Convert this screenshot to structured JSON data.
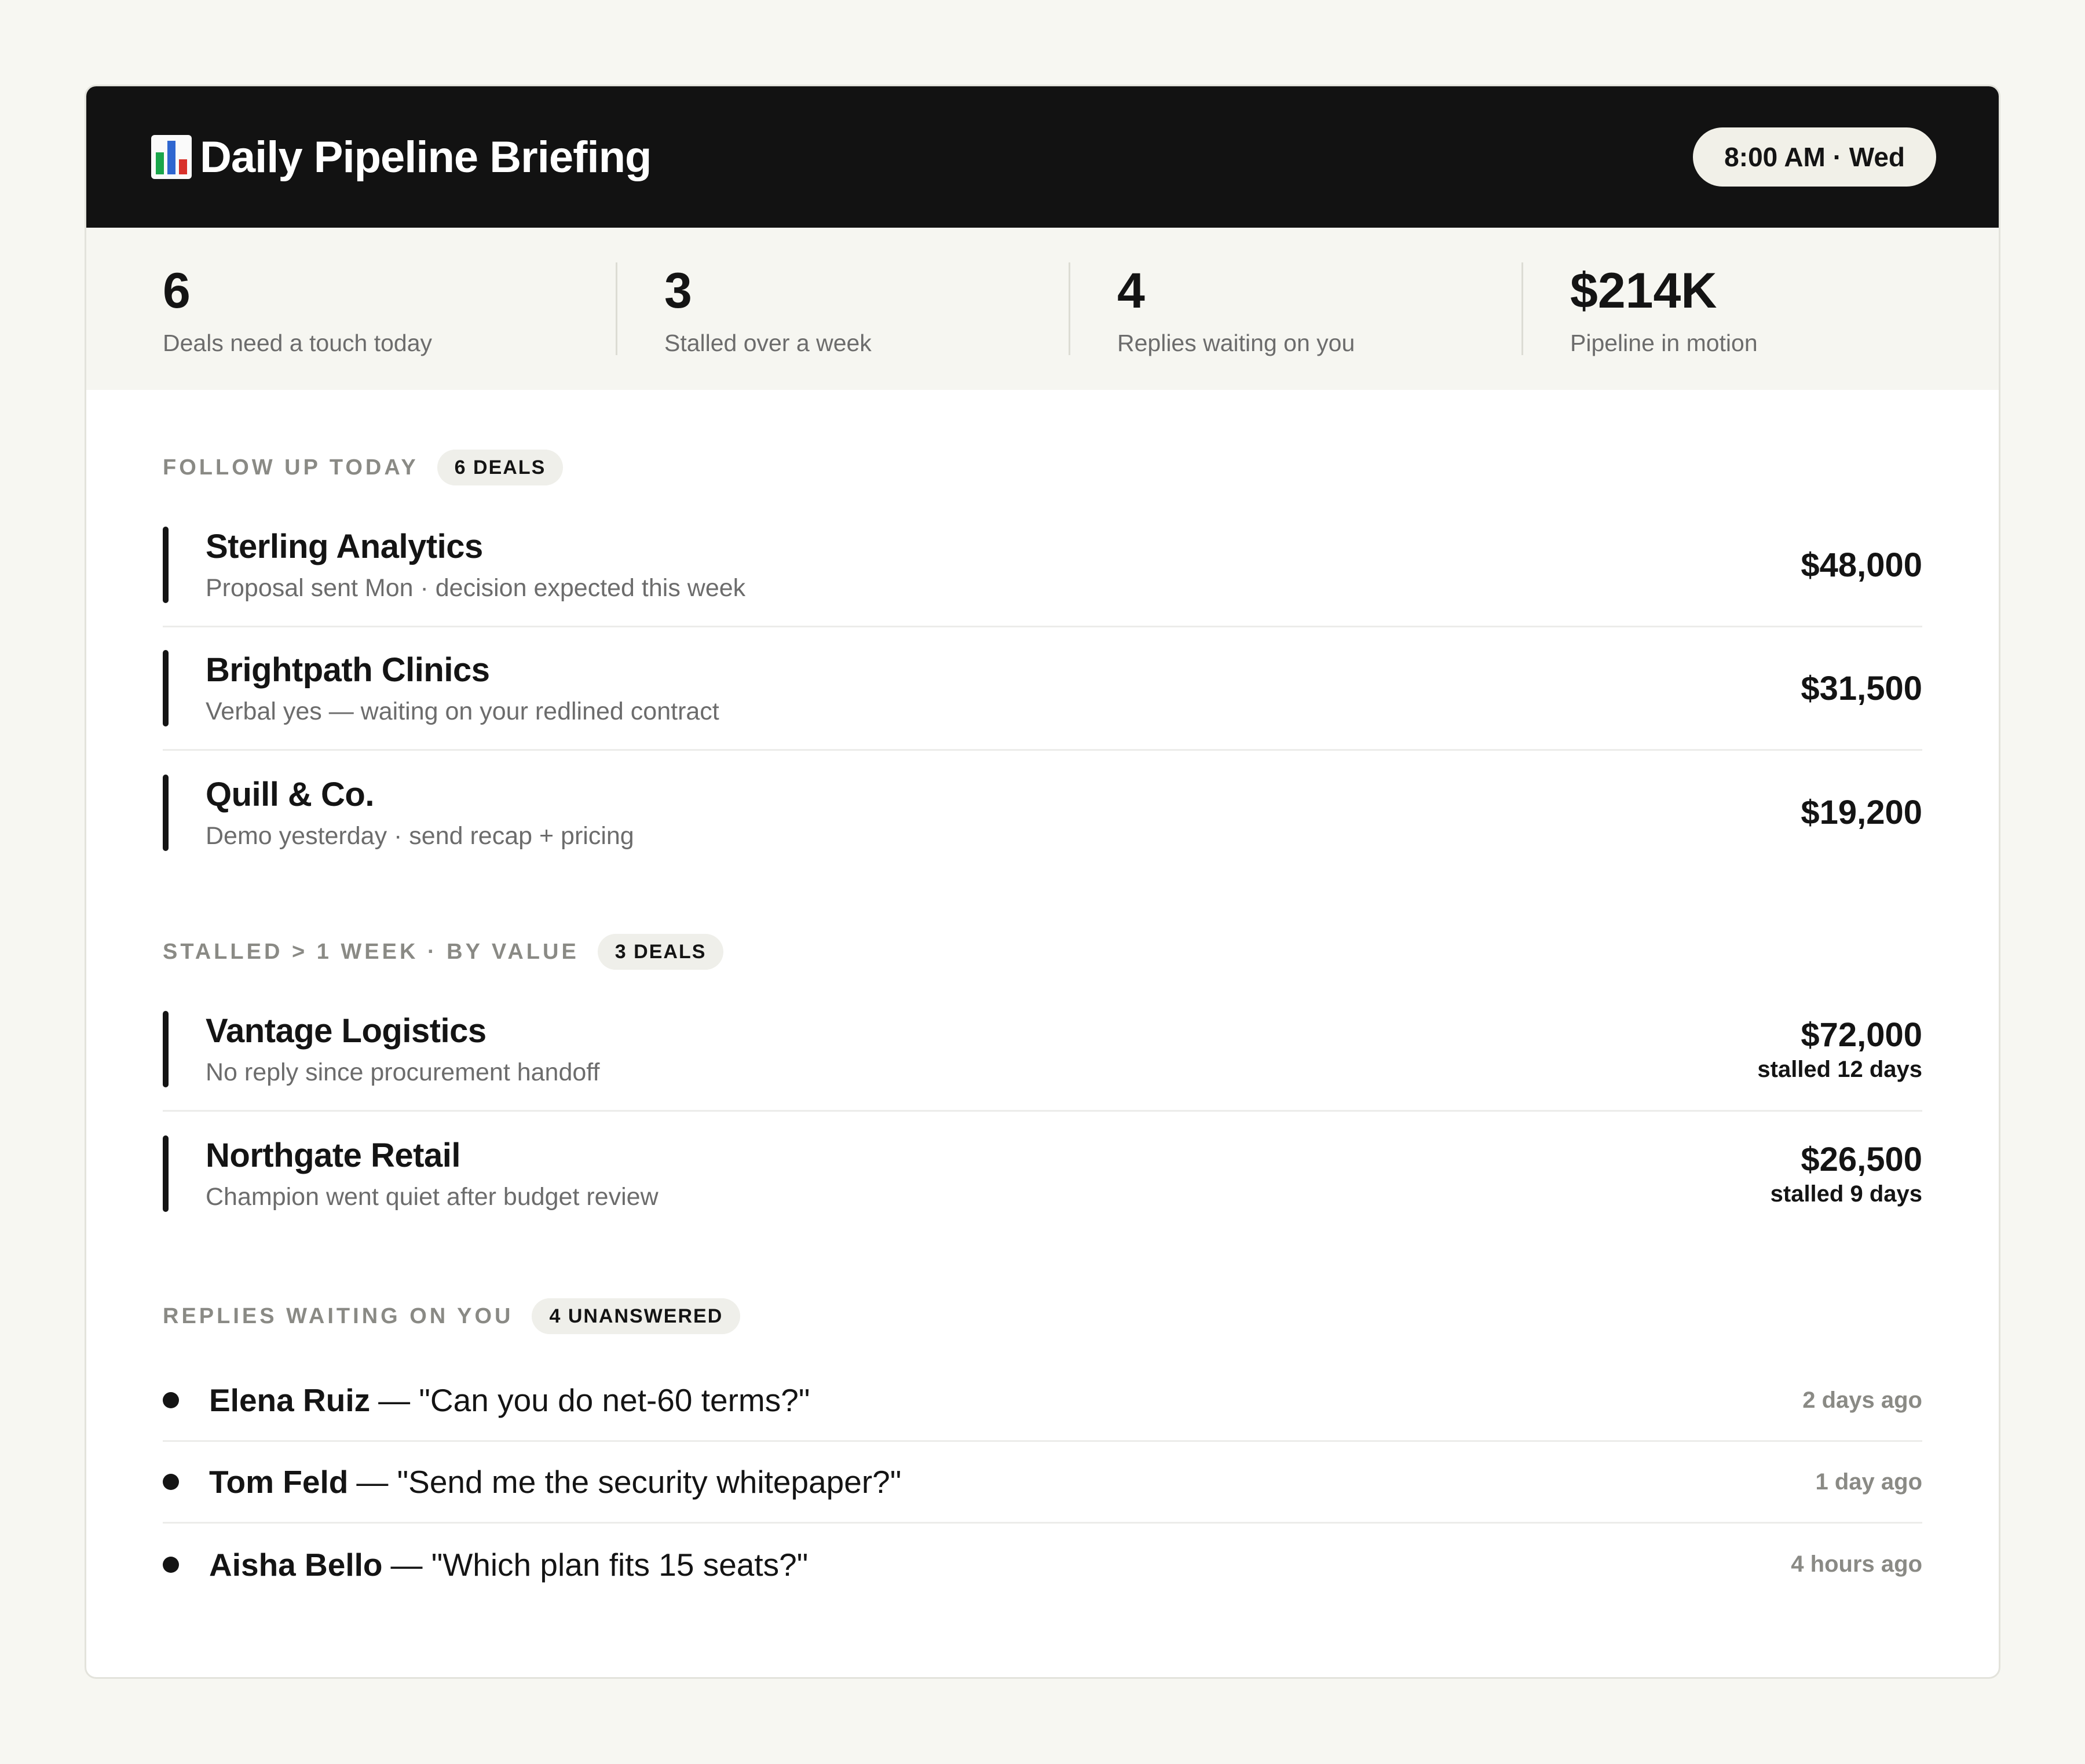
{
  "header": {
    "title": "Daily Pipeline Briefing",
    "icon": "bar-chart-icon",
    "time": "8:00 AM · Wed"
  },
  "stats": [
    {
      "value": "6",
      "label": "Deals need a touch today"
    },
    {
      "value": "3",
      "label": "Stalled over a week"
    },
    {
      "value": "4",
      "label": "Replies waiting on you"
    },
    {
      "value": "$214K",
      "label": "Pipeline in motion"
    }
  ],
  "follow_up": {
    "title": "FOLLOW UP TODAY",
    "badge": "6 DEALS",
    "deals": [
      {
        "name": "Sterling Analytics",
        "note": "Proposal sent Mon · decision expected this week",
        "amount": "$48,000"
      },
      {
        "name": "Brightpath Clinics",
        "note": "Verbal yes — waiting on your redlined contract",
        "amount": "$31,500"
      },
      {
        "name": "Quill & Co.",
        "note": "Demo yesterday · send recap + pricing",
        "amount": "$19,200"
      }
    ]
  },
  "stalled": {
    "title": "STALLED > 1 WEEK · BY VALUE",
    "badge": "3 DEALS",
    "deals": [
      {
        "name": "Vantage Logistics",
        "note": "No reply since procurement handoff",
        "amount": "$72,000",
        "stall": "stalled 12 days"
      },
      {
        "name": "Northgate Retail",
        "note": "Champion went quiet after budget review",
        "amount": "$26,500",
        "stall": "stalled 9 days"
      }
    ]
  },
  "replies": {
    "title": "REPLIES WAITING ON YOU",
    "badge": "4 UNANSWERED",
    "items": [
      {
        "name": "Elena Ruiz",
        "message": "— \"Can you do net-60 terms?\"",
        "time": "2 days ago"
      },
      {
        "name": "Tom Feld",
        "message": "— \"Send me the security whitepaper?\"",
        "time": "1 day ago"
      },
      {
        "name": "Aisha Bello",
        "message": "— \"Which plan fits 15 seats?\"",
        "time": "4 hours ago"
      }
    ]
  }
}
